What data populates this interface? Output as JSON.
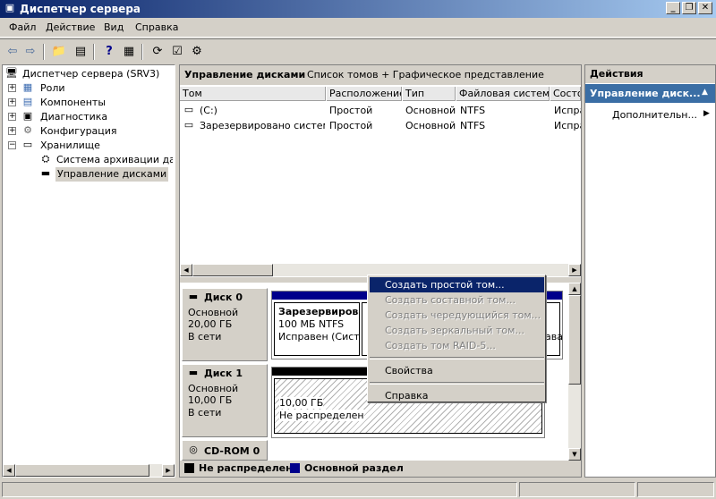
{
  "window": {
    "title": "Диспетчер сервера"
  },
  "menu": [
    "Файл",
    "Действие",
    "Вид",
    "Справка"
  ],
  "tree": {
    "root": "Диспетчер сервера (SRV3)",
    "items": [
      {
        "label": "Роли"
      },
      {
        "label": "Компоненты"
      },
      {
        "label": "Диагностика"
      },
      {
        "label": "Конфигурация"
      },
      {
        "label": "Хранилище"
      },
      {
        "label": "Система архивации данны"
      },
      {
        "label": "Управление дисками"
      }
    ]
  },
  "center": {
    "header_title": "Управление дисками",
    "header_sub": "Список томов + Графическое представление",
    "columns": [
      "Том",
      "Расположение",
      "Тип",
      "Файловая система",
      "Состо"
    ],
    "rows": [
      [
        "(C:)",
        "Простой",
        "Основной",
        "NTFS",
        "Испра"
      ],
      [
        "Зарезервировано системой",
        "Простой",
        "Основной",
        "NTFS",
        "Испра"
      ]
    ]
  },
  "disks": [
    {
      "name": "Диск 0",
      "type": "Основной",
      "size": "20,00 ГБ",
      "state": "В сети",
      "partition": {
        "title": "Зарезервирова",
        "size": "100 МБ NTFS",
        "status": "Исправен (Систем"
      },
      "partition2_tail": "ава"
    },
    {
      "name": "Диск 1",
      "type": "Основной",
      "size": "10,00 ГБ",
      "state": "В сети",
      "partition": {
        "size": "10,00 ГБ",
        "status": "Не распределен"
      }
    },
    {
      "name": "CD-ROM 0"
    }
  ],
  "legend": {
    "unallocated": "Не распределен",
    "primary": "Основной раздел"
  },
  "context_menu": {
    "items": [
      {
        "label": "Создать простой том...",
        "state": "highlighted"
      },
      {
        "label": "Создать составной том...",
        "state": "disabled"
      },
      {
        "label": "Создать чередующийся том...",
        "state": "disabled"
      },
      {
        "label": "Создать зеркальный том...",
        "state": "disabled"
      },
      {
        "label": "Создать том RAID-5...",
        "state": "disabled"
      }
    ],
    "props": "Свойства",
    "help": "Справка"
  },
  "actions": {
    "header": "Действия",
    "section": "Управление диск...",
    "more": "Дополнительн..."
  },
  "colors": {
    "accent": "#0a246a",
    "primary_partition": "#00008b"
  }
}
